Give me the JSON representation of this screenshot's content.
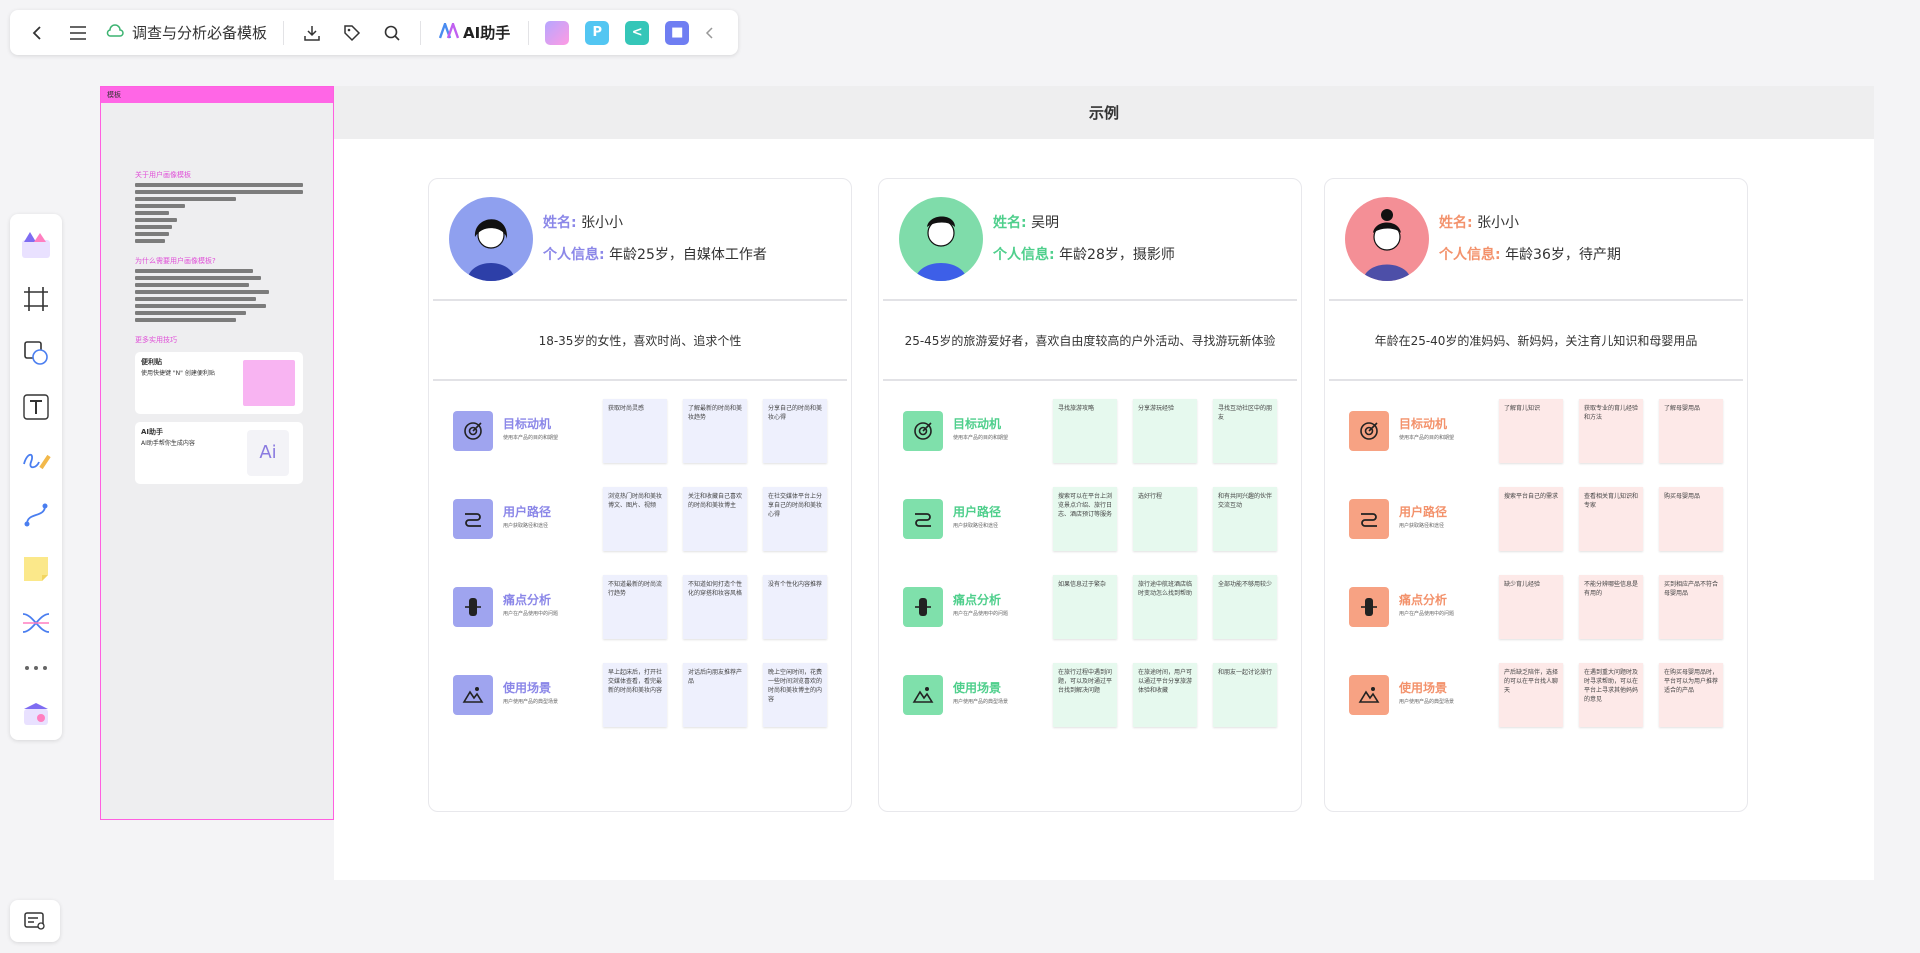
{
  "toolbar": {
    "title": "调查与分析必备模板",
    "ai_label": "AI助手"
  },
  "template_panel": {
    "header": "模板",
    "section1_title": "关于用户画像模板",
    "section1_items": [
      "...",
      "...",
      "..."
    ],
    "section2_title": "为什么需要用户画像模板?",
    "section3_title": "更多实用技巧",
    "tip1_title": "便利贴",
    "tip1_text": "使用快捷键 \"N\" 创建便利贴",
    "tip2_title": "AI助手",
    "tip2_text": "AI助手帮你生成内容",
    "tip2_badge": "Ai"
  },
  "board": {
    "title": "示例",
    "name_label": "姓名:",
    "info_label": "个人信息:",
    "row_titles": [
      "目标动机",
      "用户路径",
      "痛点分析",
      "使用场景"
    ],
    "row_subtitles": [
      "使用本产品的目的和期望",
      "用户获取路径和途径",
      "用户在产品使用中的问题",
      "用户使用产品的典型场景"
    ],
    "personas": [
      {
        "name": "张小小",
        "info": "年龄25岁，自媒体工作者",
        "desc": "18-35岁的女性，喜欢时尚、追求个性",
        "accent": "#8b87e8",
        "soft": "#eef0fd",
        "icon_bg": "#9fa4ef",
        "avatar_bg": "#8fa0ef",
        "notes": [
          [
            "获取时尚灵感",
            "了解最新的时尚和美妆趋势",
            "分享自己的时尚和美妆心得"
          ],
          [
            "浏览热门时尚和美妆博文、图片、视频",
            "关注和收藏自己喜欢的时尚和美妆博主",
            "在社交媒体平台上分享自己的时尚和美妆心得"
          ],
          [
            "不知道最新的时尚流行趋势",
            "不知道如何打造个性化的穿搭和妆容风格",
            "没有个性化内容推荐"
          ],
          [
            "早上起床后，打开社交媒体查看，看完最新的时尚和美妆内容",
            "对话后向朋友推荐产品",
            "晚上空闲时间，花费一些时间浏览喜欢的时尚和美妆博主的内容"
          ]
        ]
      },
      {
        "name": "吴明",
        "info": "年龄28岁，摄影师",
        "desc": "25-45岁的旅游爱好者，喜欢自由度较高的户外活动、寻找游玩新体验",
        "accent": "#4fcf8c",
        "soft": "#e6f9ee",
        "icon_bg": "#7fe0ab",
        "avatar_bg": "#7fdcaa",
        "notes": [
          [
            "寻找旅游攻略",
            "分享游玩经验",
            "寻找互动社区中的朋友"
          ],
          [
            "搜索可以在平台上浏览景点介绍、旅行日志、酒店预订等服务",
            "选好行程",
            "和有共同兴趣的伙伴交流互动"
          ],
          [
            "如果信息过于繁杂",
            "旅行途中航班酒店临时变动怎么找到帮助",
            "全部功能不够用较少"
          ],
          [
            "在旅行过程中遇到问题，可以及时通过平台找到解决问题",
            "在旅途时间，用户可以通过平台分享旅游体验和收藏",
            "和朋友一起讨论旅行"
          ]
        ]
      },
      {
        "name": "张小小",
        "info": "年龄36岁，待产期",
        "desc": "年龄在25-40岁的准妈妈、新妈妈，关注育儿知识和母婴用品",
        "accent": "#f3926c",
        "soft": "#fde9e8",
        "icon_bg": "#f7a283",
        "avatar_bg": "#f48f96",
        "notes": [
          [
            "了解育儿知识",
            "获取专业的育儿经验和方法",
            "了解母婴用品"
          ],
          [
            "搜索平台自己的需求",
            "查看相关育儿知识和专家",
            "购买母婴用品"
          ],
          [
            "缺少育儿经验",
            "不能分辨哪些信息是有用的",
            "买到相应产品不符合母婴用品"
          ],
          [
            "产后缺乏陪伴，选择的可以在平台找人聊天",
            "在遇到重大问题时及时寻求帮助，可以在平台上寻求其他妈妈的意见",
            "在购买母婴用品时，平台可以为用户推荐适合的产品"
          ]
        ]
      }
    ]
  }
}
